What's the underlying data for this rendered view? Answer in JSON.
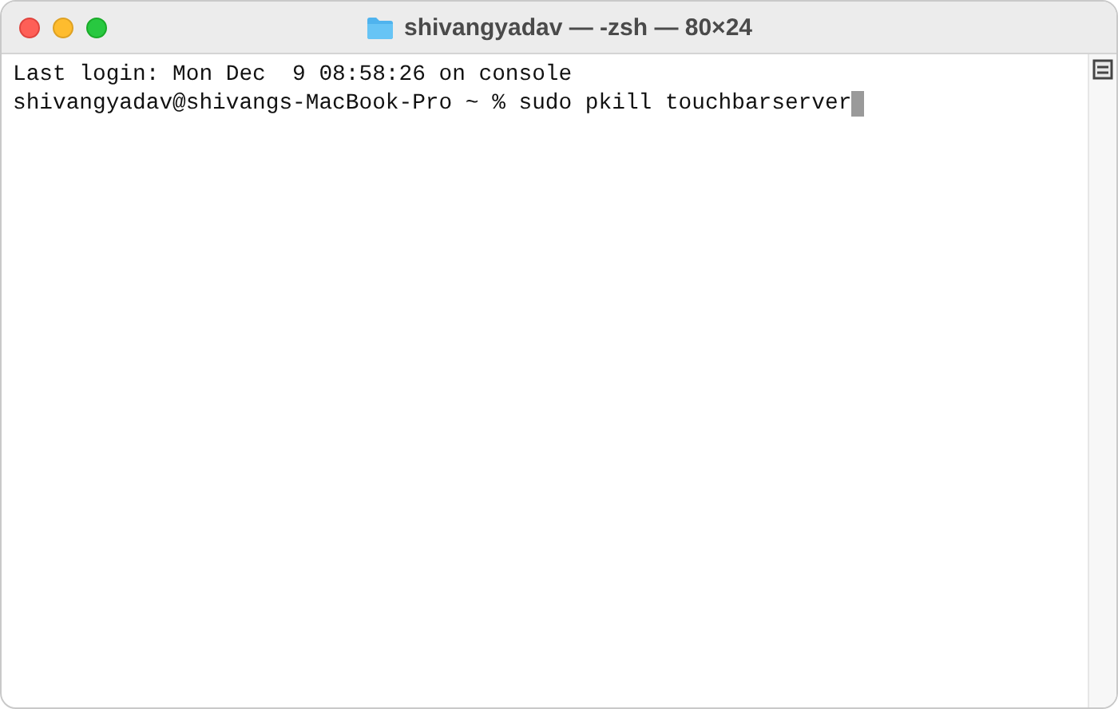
{
  "window": {
    "title": "shivangyadav — -zsh — 80×24"
  },
  "terminal": {
    "lines": [
      {
        "text": "Last login: Mon Dec  9 08:58:26 on console",
        "cursor": false
      },
      {
        "text": "shivangyadav@shivangs-MacBook-Pro ~ % sudo pkill touchbarserver",
        "cursor": true
      }
    ]
  }
}
